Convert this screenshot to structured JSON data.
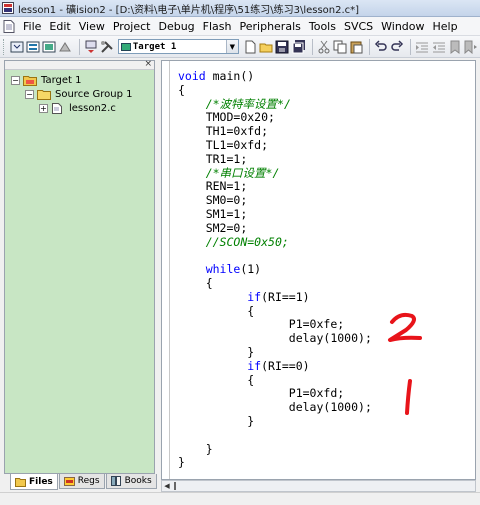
{
  "window": {
    "title": "lesson1  - 礦ision2 - [D:\\资料\\电子\\单片机\\程序\\51练习\\练习3\\lesson2.c*]"
  },
  "menu": {
    "items": [
      "File",
      "Edit",
      "View",
      "Project",
      "Debug",
      "Flash",
      "Peripherals",
      "Tools",
      "SVCS",
      "Window",
      "Help"
    ]
  },
  "toolbar": {
    "target_select_value": "Target 1",
    "icons": [
      "translate-icon",
      "build-icon",
      "rebuild-icon",
      "stop-build-icon",
      "download-icon",
      "options-icon",
      "new-file-icon",
      "open-file-icon",
      "save-icon",
      "save-all-icon",
      "cut-icon",
      "copy-icon",
      "paste-icon",
      "undo-icon",
      "redo-icon",
      "indent-icon",
      "unindent-icon",
      "bookmark-icon",
      "next-bookmark-icon"
    ]
  },
  "project_tree": {
    "root": "Target 1",
    "group": "Source Group 1",
    "file": "lesson2.c"
  },
  "bottom_tabs": {
    "files": "Files",
    "regs": "Regs",
    "books": "Books"
  },
  "editor": {
    "lines": [
      {
        "indent": 0,
        "parts": [
          {
            "t": "kw",
            "v": "void"
          },
          {
            "t": "n",
            "v": " main()"
          }
        ]
      },
      {
        "indent": 0,
        "parts": [
          {
            "t": "n",
            "v": "{"
          }
        ]
      },
      {
        "indent": 4,
        "parts": [
          {
            "t": "cm",
            "v": "/*波特率设置*/"
          }
        ]
      },
      {
        "indent": 4,
        "parts": [
          {
            "t": "n",
            "v": "TMOD=0x20;"
          }
        ]
      },
      {
        "indent": 4,
        "parts": [
          {
            "t": "n",
            "v": "TH1=0xfd;"
          }
        ]
      },
      {
        "indent": 4,
        "parts": [
          {
            "t": "n",
            "v": "TL1=0xfd;"
          }
        ]
      },
      {
        "indent": 4,
        "parts": [
          {
            "t": "n",
            "v": "TR1=1;"
          }
        ]
      },
      {
        "indent": 4,
        "parts": [
          {
            "t": "cm",
            "v": "/*串口设置*/"
          }
        ]
      },
      {
        "indent": 4,
        "parts": [
          {
            "t": "n",
            "v": "REN=1;"
          }
        ]
      },
      {
        "indent": 4,
        "parts": [
          {
            "t": "n",
            "v": "SM0=0;"
          }
        ]
      },
      {
        "indent": 4,
        "parts": [
          {
            "t": "n",
            "v": "SM1=1;"
          }
        ]
      },
      {
        "indent": 4,
        "parts": [
          {
            "t": "n",
            "v": "SM2=0;"
          }
        ]
      },
      {
        "indent": 4,
        "parts": [
          {
            "t": "cm",
            "v": "//SCON=0x50;"
          }
        ]
      },
      {
        "indent": 0,
        "parts": []
      },
      {
        "indent": 4,
        "parts": [
          {
            "t": "kw",
            "v": "while"
          },
          {
            "t": "n",
            "v": "(1)"
          }
        ]
      },
      {
        "indent": 4,
        "parts": [
          {
            "t": "n",
            "v": "{"
          }
        ]
      },
      {
        "indent": 10,
        "parts": [
          {
            "t": "kw",
            "v": "if"
          },
          {
            "t": "n",
            "v": "(RI==1)"
          }
        ]
      },
      {
        "indent": 10,
        "parts": [
          {
            "t": "n",
            "v": "{"
          }
        ]
      },
      {
        "indent": 16,
        "parts": [
          {
            "t": "n",
            "v": "P1=0xfe;"
          }
        ]
      },
      {
        "indent": 16,
        "parts": [
          {
            "t": "n",
            "v": "delay(1000);"
          }
        ]
      },
      {
        "indent": 10,
        "parts": [
          {
            "t": "n",
            "v": "}"
          }
        ]
      },
      {
        "indent": 10,
        "parts": [
          {
            "t": "kw",
            "v": "if"
          },
          {
            "t": "n",
            "v": "(RI==0)"
          }
        ]
      },
      {
        "indent": 10,
        "parts": [
          {
            "t": "n",
            "v": "{"
          }
        ]
      },
      {
        "indent": 16,
        "parts": [
          {
            "t": "n",
            "v": "P1=0xfd;"
          }
        ]
      },
      {
        "indent": 16,
        "parts": [
          {
            "t": "n",
            "v": "delay(1000);"
          }
        ]
      },
      {
        "indent": 10,
        "parts": [
          {
            "t": "n",
            "v": "}"
          }
        ]
      },
      {
        "indent": 0,
        "parts": []
      },
      {
        "indent": 4,
        "parts": [
          {
            "t": "n",
            "v": "}"
          }
        ]
      },
      {
        "indent": 0,
        "parts": [
          {
            "t": "n",
            "v": "}"
          }
        ]
      }
    ]
  },
  "annotations": [
    {
      "text": "2",
      "color": "#e8141a"
    },
    {
      "text": "1",
      "color": "#e8141a"
    }
  ],
  "colors": {
    "keyword": "#0000ff",
    "comment": "#008000",
    "panel_bg": "#c8e6c4",
    "annotation": "#e8141a"
  }
}
